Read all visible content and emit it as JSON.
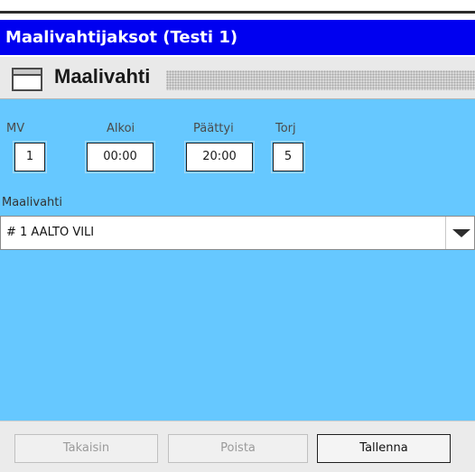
{
  "window": {
    "title": "Maalivahtijaksot (Testi 1)"
  },
  "panel": {
    "title": "Maalivahti",
    "icon": "window-icon"
  },
  "columns": {
    "mv_label": "MV",
    "start_label": "Alkoi",
    "end_label": "Päättyi",
    "saves_label": "Torj"
  },
  "fields": {
    "mv": "1",
    "start": "00:00",
    "end": "20:00",
    "saves": "5"
  },
  "goalkeeper": {
    "label": "Maalivahti",
    "selected": "# 1 AALTO VILI",
    "arrow_icon": "chevron-down-icon"
  },
  "buttons": {
    "back": "Takaisin",
    "delete": "Poista",
    "save": "Tallenna"
  },
  "colors": {
    "titlebar": "#0000f0",
    "content_background": "#66c8ff",
    "footer": "#ebebeb"
  }
}
